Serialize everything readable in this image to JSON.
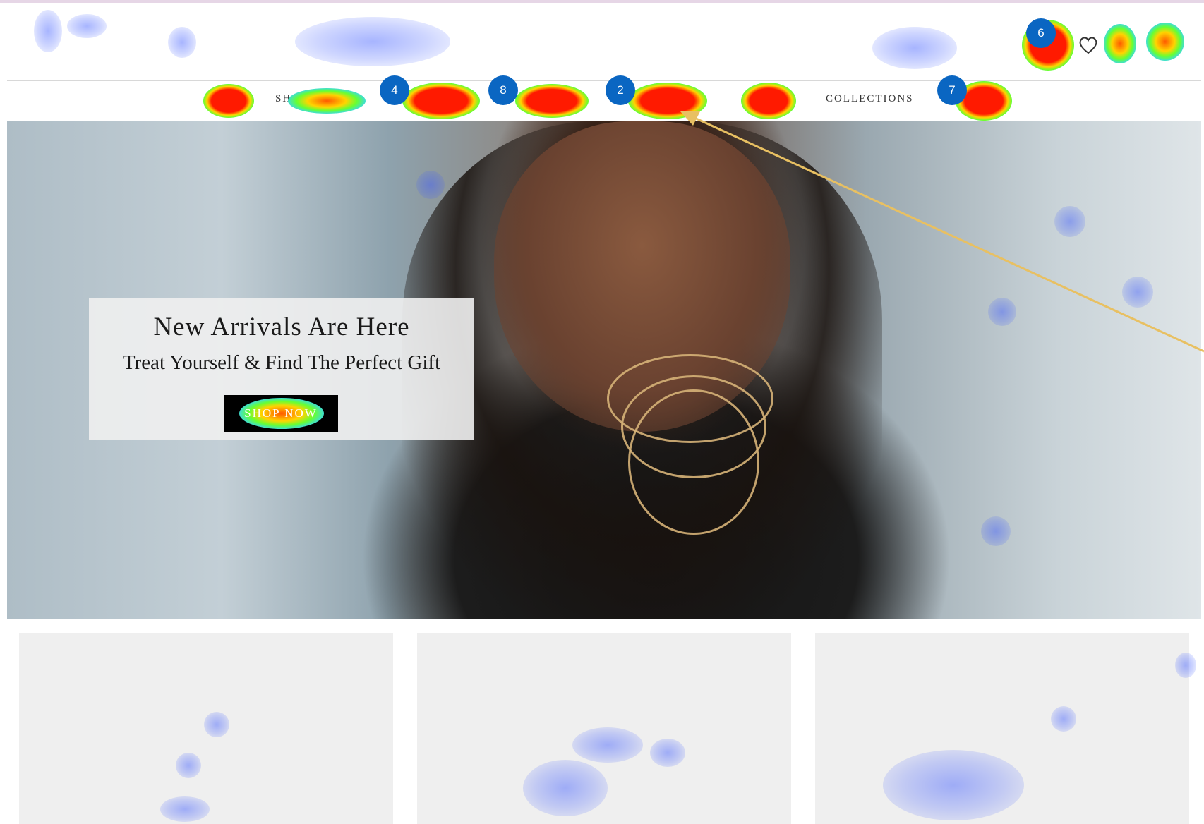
{
  "colors": {
    "nav_text": "#333333",
    "badge_blue": "#0a66c2",
    "arrow_gold": "#e8c062",
    "card_bg": "#efefef",
    "button_bg": "#000000"
  },
  "header": {
    "icons": [
      {
        "name": "cart-icon"
      },
      {
        "name": "heart-icon"
      },
      {
        "name": "account-icon"
      },
      {
        "name": "bag-icon"
      }
    ]
  },
  "nav": {
    "items": [
      {
        "label": ""
      },
      {
        "label": "SHOP INSTA"
      },
      {
        "label": "S"
      },
      {
        "label": "S"
      },
      {
        "label": "S"
      },
      {
        "label": ""
      },
      {
        "label": "COLLECTIONS"
      },
      {
        "label": ""
      }
    ]
  },
  "heatmap": {
    "badges": [
      {
        "number": "6"
      },
      {
        "number": "4"
      },
      {
        "number": "8"
      },
      {
        "number": "2"
      },
      {
        "number": "7"
      }
    ]
  },
  "hero": {
    "title": "New Arrivals Are Here",
    "subtitle": "Treat Yourself & Find The Perfect Gift",
    "button_label": "SHOP NOW"
  },
  "cards": [
    {
      "name": "product-card-1"
    },
    {
      "name": "product-card-2"
    },
    {
      "name": "product-card-3"
    }
  ]
}
